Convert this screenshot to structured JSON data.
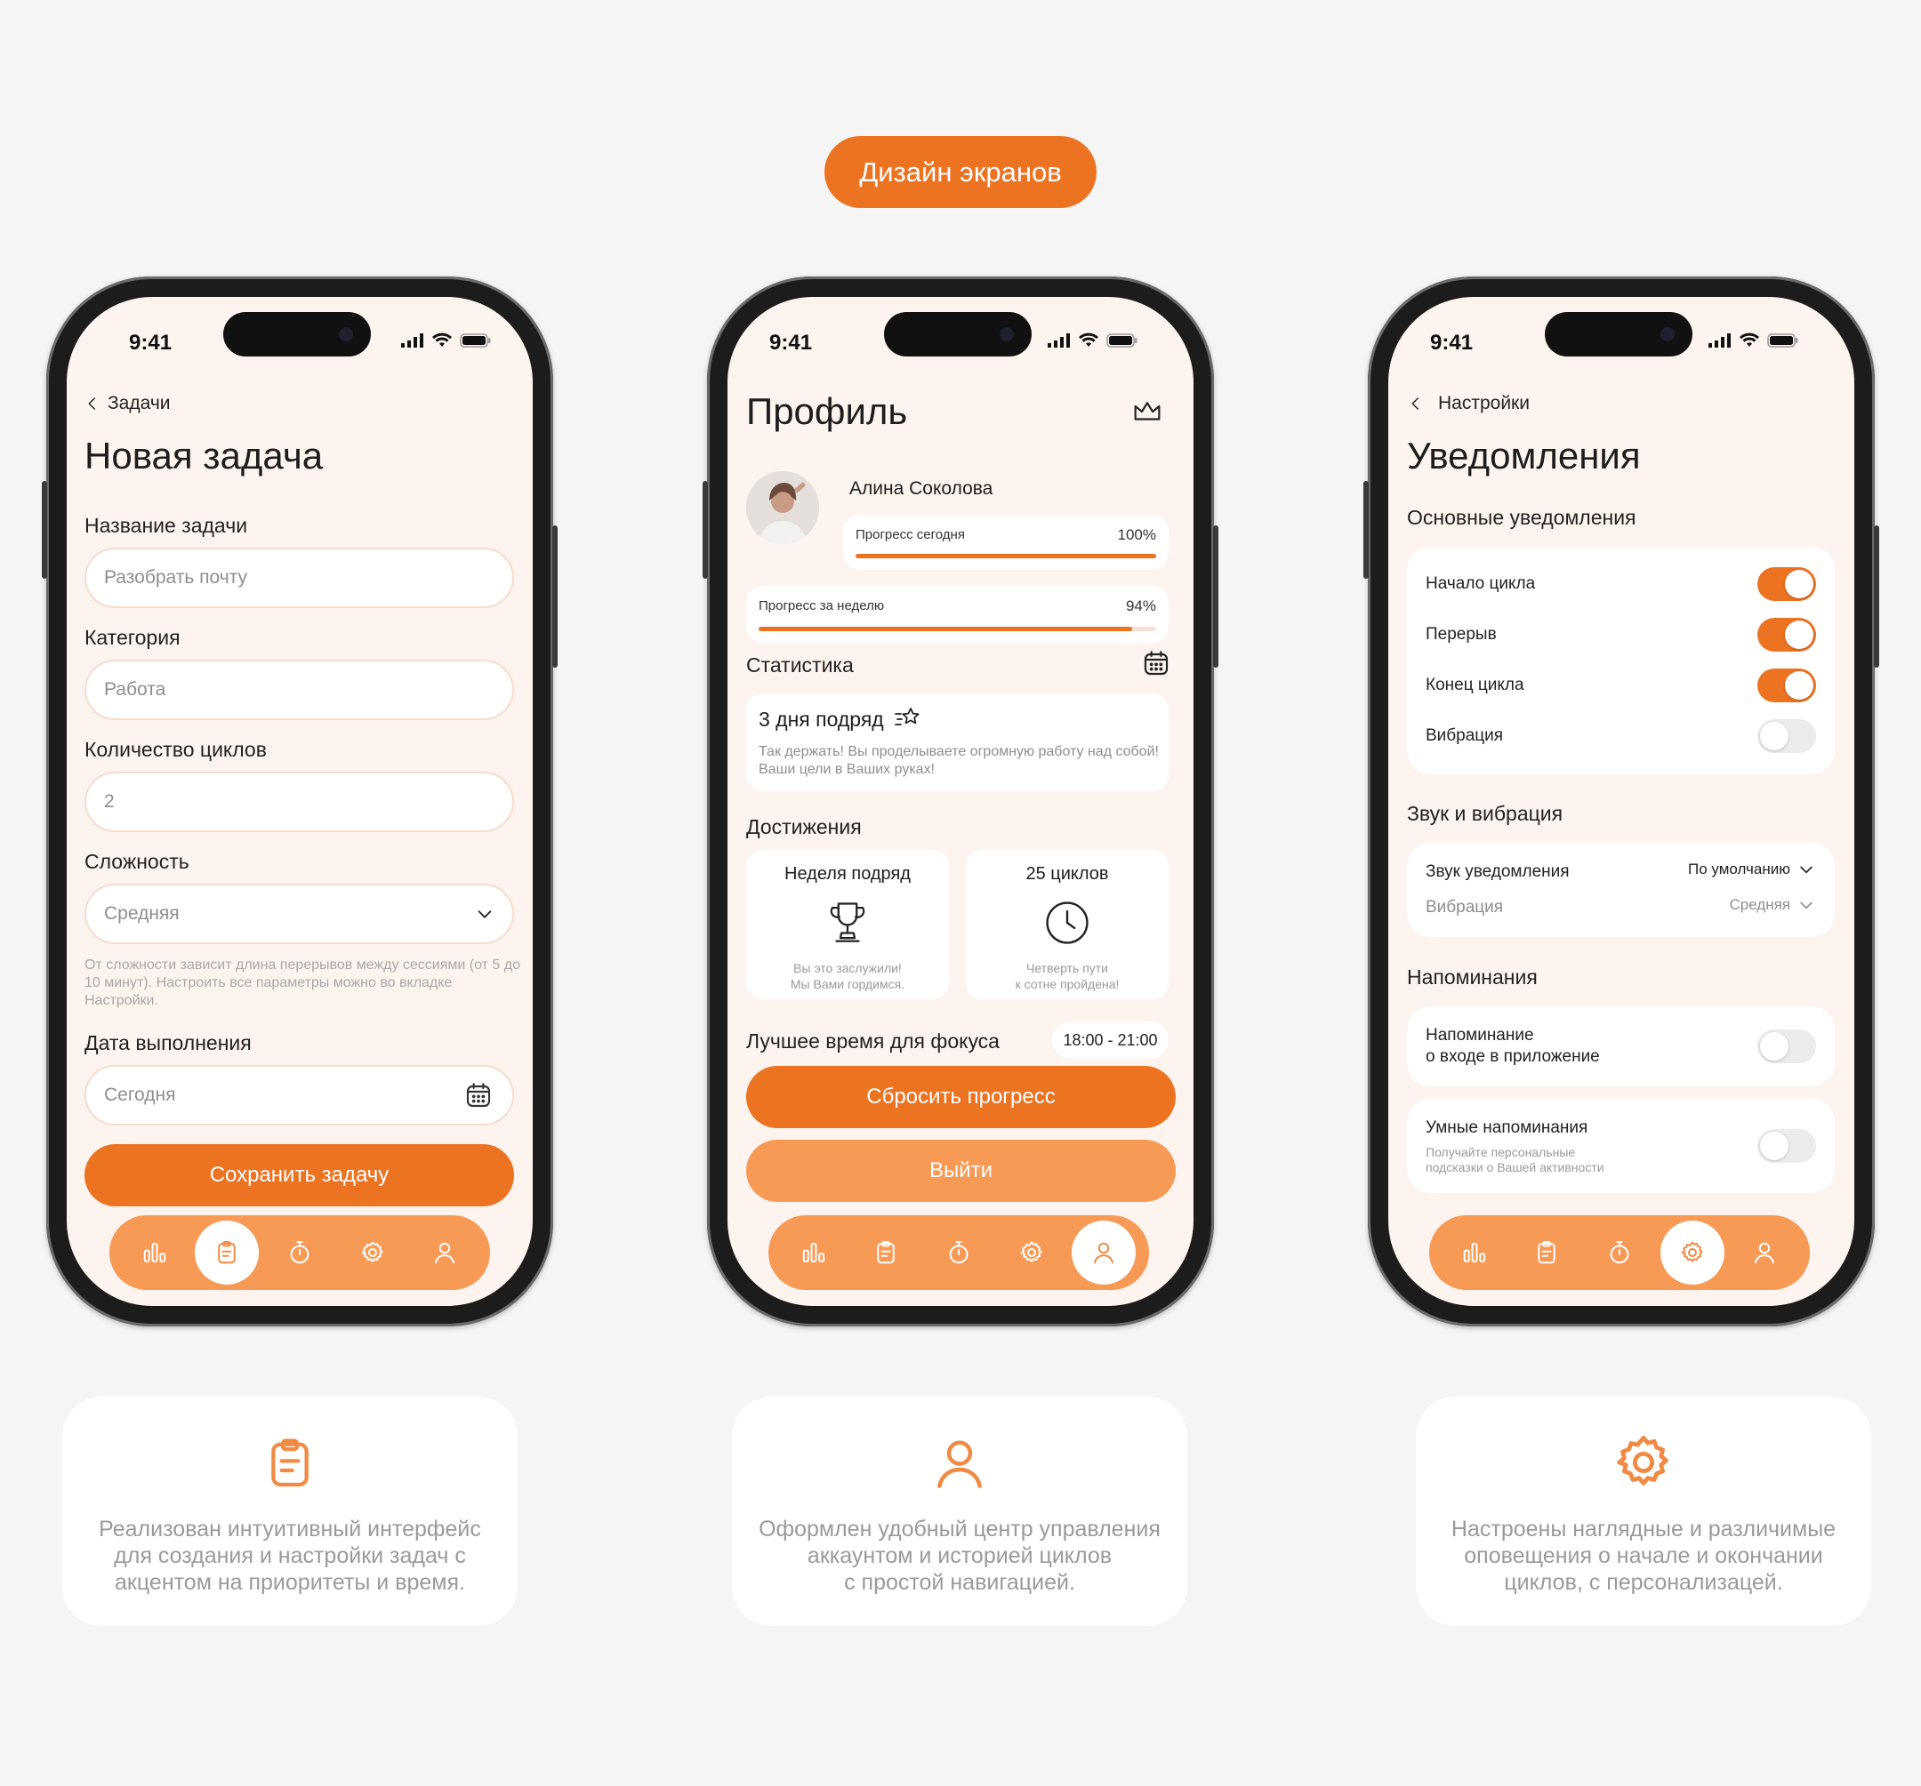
{
  "header_pill": "Дизайн экранов",
  "status_time": "9:41",
  "screen1": {
    "back": "Задачи",
    "title": "Новая задача",
    "name_label": "Название задачи",
    "name_value": "Разобрать почту",
    "category_label": "Категория",
    "category_value": "Работа",
    "cycles_label": "Количество циклов",
    "cycles_value": "2",
    "difficulty_label": "Сложность",
    "difficulty_value": "Средняя",
    "hint": "От сложности зависит длина перерывов между сессиями (от 5 до 10 минут). Настроить все параметры можно во вкладке Настройки.",
    "date_label": "Дата выполнения",
    "date_value": "Сегодня",
    "save_button": "Сохранить задачу"
  },
  "screen2": {
    "title": "Профиль",
    "user_name": "Алина Соколова",
    "today_label": "Прогресс сегодня",
    "today_value": "100%",
    "today_progress": 1.0,
    "week_label": "Прогресс за неделю",
    "week_value": "94%",
    "week_progress": 0.94,
    "stats_title": "Статистика",
    "streak_title": "3 дня подряд",
    "streak_text": "Так держать! Вы проделываете огромную работу над собой! Ваши цели в Ваших руках!",
    "achievements_title": "Достижения",
    "ach1_title": "Неделя подряд",
    "ach1_text_1": "Вы это заслужили!",
    "ach1_text_2": "Мы Вами гордимся.",
    "ach2_title": "25 циклов",
    "ach2_text_1": "Четверть пути",
    "ach2_text_2": "к сотне пройдена!",
    "focus_label": "Лучшее время для фокуса",
    "focus_value": "18:00 - 21:00",
    "reset_button": "Сбросить прогресс",
    "logout_button": "Выйти"
  },
  "screen3": {
    "back": "Настройки",
    "title": "Уведомления",
    "section1": "Основные уведомления",
    "toggles": [
      {
        "label": "Начало цикла",
        "on": true
      },
      {
        "label": "Перерыв",
        "on": true
      },
      {
        "label": "Конец цикла",
        "on": true
      },
      {
        "label": "Вибрация",
        "on": false
      }
    ],
    "section2": "Звук и вибрация",
    "sound_label": "Звук уведомления",
    "sound_value": "По умолчанию",
    "vibration_label": "Вибрация",
    "vibration_value": "Средняя",
    "section3": "Напоминания",
    "reminder1_line1": "Напоминание",
    "reminder1_line2": "о входе в приложение",
    "reminder2_title": "Умные напоминания",
    "reminder2_sub_1": "Получайте персональные",
    "reminder2_sub_2": "подсказки о Вашей активности"
  },
  "descriptions": [
    {
      "icon": "clipboard-icon",
      "line1": "Реализован интуитивный интерфейс",
      "line2": "для создания и настройки задач с",
      "line3": "акцентом на приоритеты и время."
    },
    {
      "icon": "user-icon",
      "line1": "Оформлен удобный центр управления",
      "line2": "аккаунтом и историей циклов",
      "line3": "с простой навигацией."
    },
    {
      "icon": "gear-icon",
      "line1": "Настроены наглядные и различимые",
      "line2": "оповещения о начале и окончании",
      "line3": "циклов, с персонализацей."
    }
  ],
  "colors": {
    "accent": "#ec7322",
    "accent_light": "#f79a55",
    "screen_bg": "#fdf4ef"
  }
}
